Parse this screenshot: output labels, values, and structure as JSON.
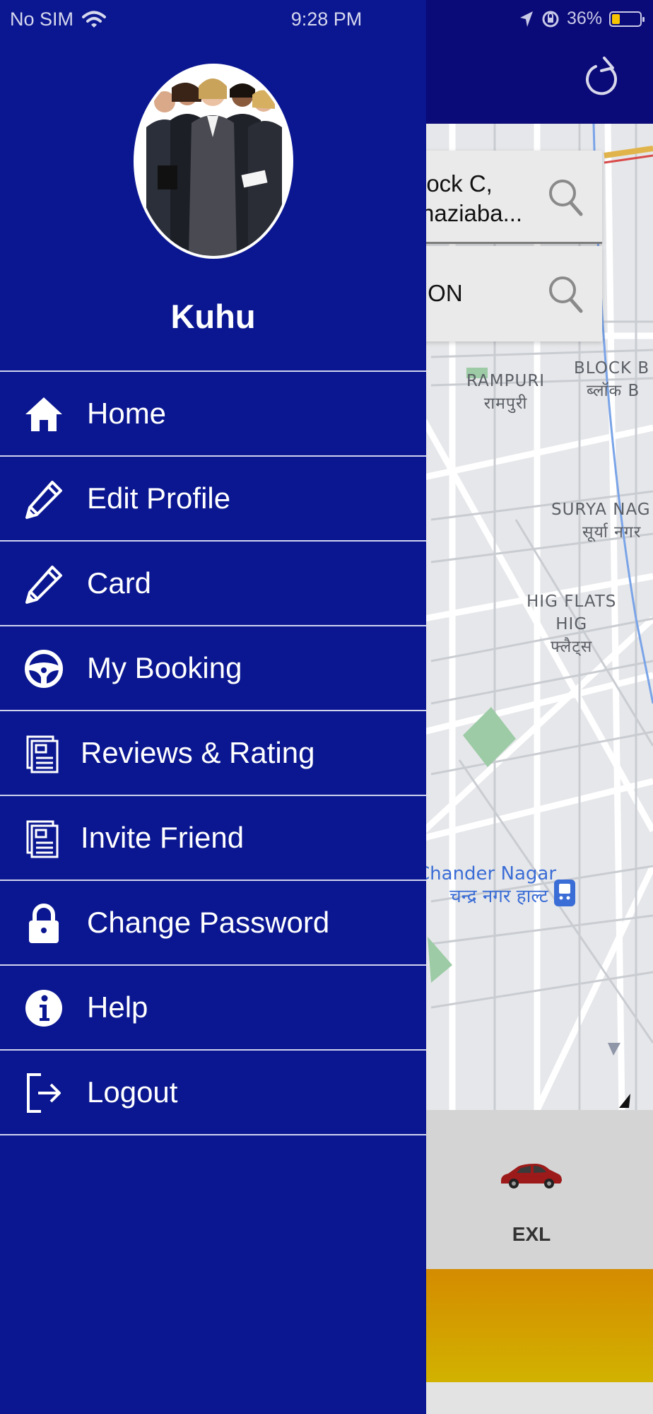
{
  "status_bar": {
    "carrier": "No SIM",
    "time": "9:28 PM",
    "battery": "36%"
  },
  "map": {
    "pickup_text_line1": "lock C,",
    "pickup_text_line2": "haziaba...",
    "drop_text": "ION",
    "labels": {
      "rampuri_en": "RAMPURI",
      "rampuri_hi": "रामपुरी",
      "block_b_en": "BLOCK B",
      "block_b_hi": "ब्लॉक B",
      "surya_en": "SURYA NAG",
      "surya_hi": "सूर्या नगर",
      "hig_en1": "HIG FLATS",
      "hig_en2": "HIG",
      "hig_hi": "फ्लैट्स",
      "chander_en": "Chander Nagar",
      "chander_hi": "चन्द्र नगर हाल्ट"
    }
  },
  "vehicle": {
    "label": "EXL"
  },
  "drawer": {
    "user_name": "Kuhu",
    "menu": [
      {
        "label": "Home",
        "icon": "home-icon"
      },
      {
        "label": "Edit Profile",
        "icon": "pencil-icon"
      },
      {
        "label": "Card",
        "icon": "pencil-icon"
      },
      {
        "label": "My Booking",
        "icon": "steering-wheel-icon"
      },
      {
        "label": "Reviews & Rating",
        "icon": "receipt-icon"
      },
      {
        "label": "Invite Friend",
        "icon": "receipt-icon"
      },
      {
        "label": "Change Password",
        "icon": "lock-icon"
      },
      {
        "label": "Help",
        "icon": "info-icon"
      },
      {
        "label": "Logout",
        "icon": "logout-icon"
      }
    ]
  },
  "colors": {
    "drawer_bg": "#0b1790",
    "header_bg": "#0a0a78",
    "book_bar": "#d2a000"
  }
}
